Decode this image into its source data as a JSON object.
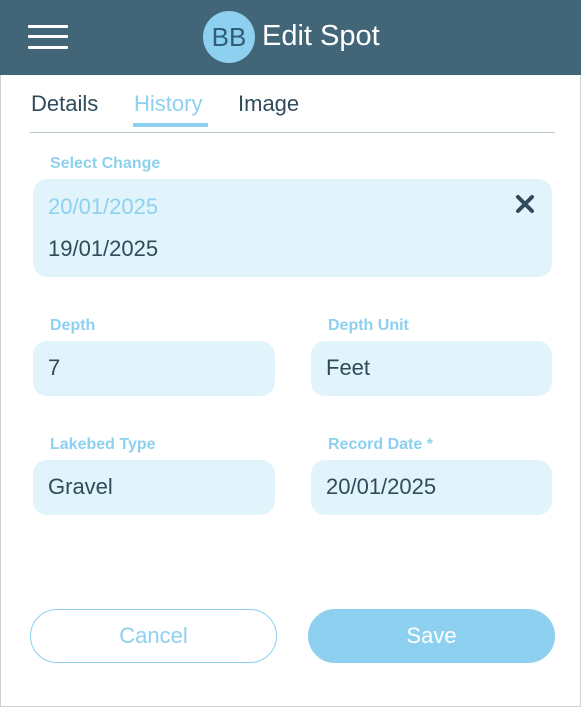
{
  "header": {
    "avatar_initials": "BB",
    "title": "Edit Spot"
  },
  "tabs": [
    {
      "label": "Details",
      "active": false
    },
    {
      "label": "History",
      "active": true
    },
    {
      "label": "Image",
      "active": false
    }
  ],
  "form": {
    "select_change": {
      "label": "Select Change",
      "selected": "20/01/2025",
      "options": [
        "19/01/2025"
      ]
    },
    "depth": {
      "label": "Depth",
      "value": "7"
    },
    "depth_unit": {
      "label": "Depth Unit",
      "value": "Feet"
    },
    "lakebed_type": {
      "label": "Lakebed Type",
      "value": "Gravel"
    },
    "record_date": {
      "label": "Record Date *",
      "value": "20/01/2025"
    }
  },
  "actions": {
    "cancel_label": "Cancel",
    "save_label": "Save"
  },
  "colors": {
    "header_bg": "#426677",
    "accent": "#8dd0ef",
    "field_bg": "#e1f3fb",
    "text": "#2f4b5c"
  },
  "icons": {
    "menu": "hamburger-menu-icon",
    "clear": "close-icon"
  }
}
